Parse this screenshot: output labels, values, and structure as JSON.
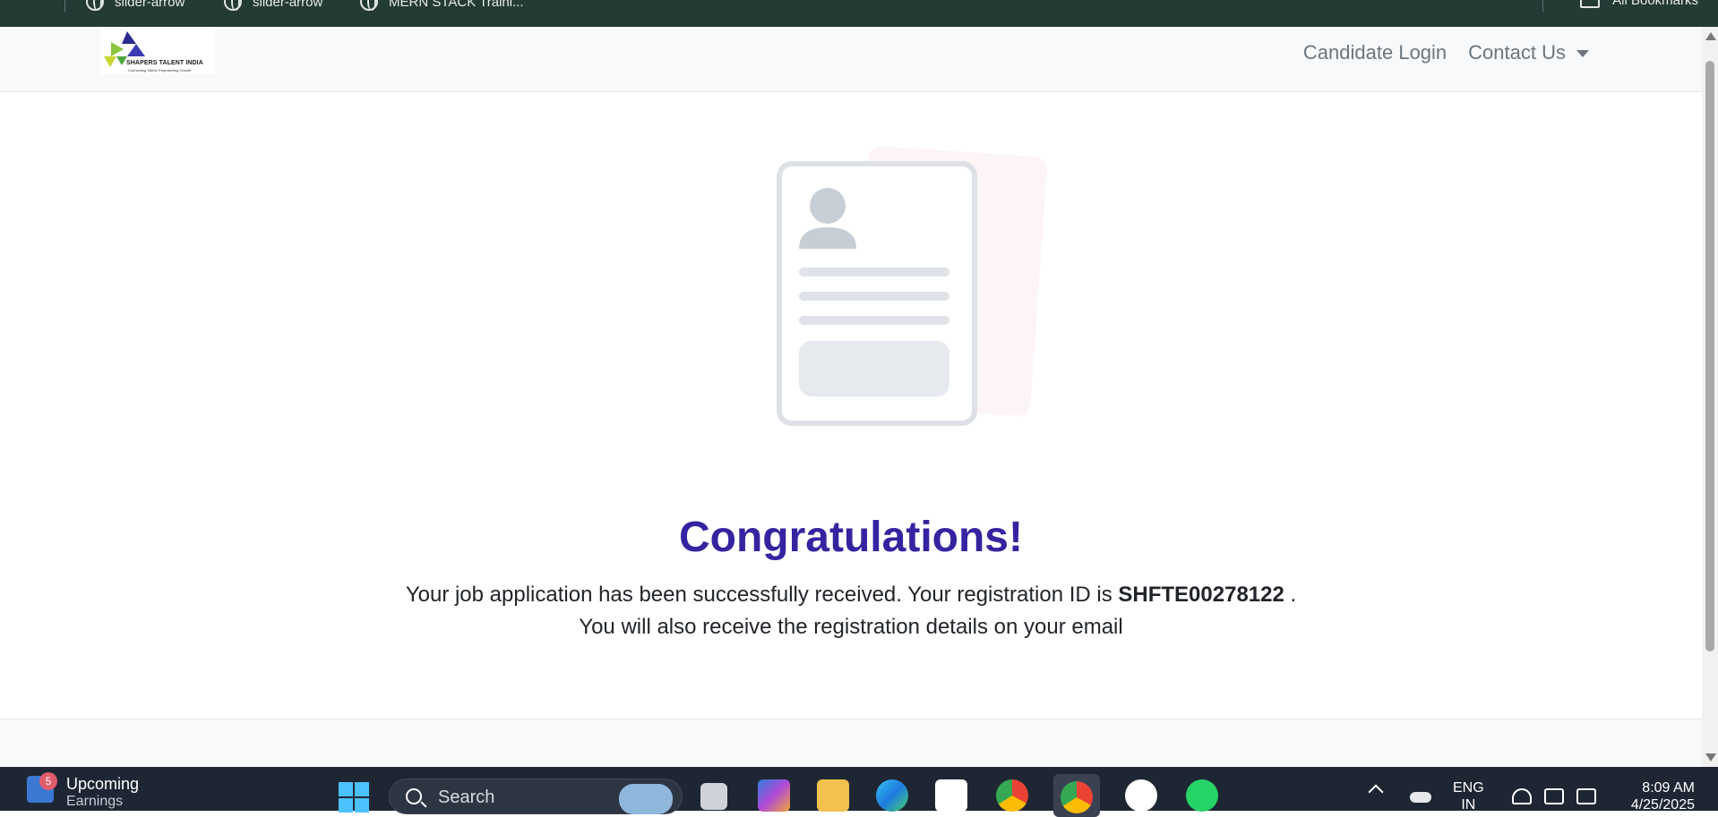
{
  "bookmarks": {
    "items": [
      {
        "label": "slider-arrow"
      },
      {
        "label": "slider-arrow"
      },
      {
        "label": "MERN STACK Traini..."
      }
    ],
    "all_bookmarks": "All Bookmarks"
  },
  "header": {
    "logo": {
      "name": "SHAPERS TALENT INDIA",
      "tagline": "Connecting Talent, Empowering Growth"
    },
    "nav": {
      "candidate_login": "Candidate Login",
      "contact_us": "Contact Us"
    }
  },
  "main": {
    "title": "Congratulations!",
    "message_prefix": "Your job application has been successfully received. Your registration ID is",
    "registration_id": "SHFTE00278122",
    "message_suffix": " .",
    "message_line2": "You will also receive the registration details on your email"
  },
  "colors": {
    "title": "#3524a0",
    "bookmark_bar": "#233a35",
    "taskbar": "#1f2633"
  },
  "taskbar": {
    "widget": {
      "badge": "5",
      "title": "Upcoming",
      "subtitle": "Earnings"
    },
    "search_placeholder": "Search",
    "apps": [
      "task-view-icon",
      "copilot-icon",
      "file-explorer-icon",
      "edge-icon",
      "microsoft-store-icon",
      "chrome-profile-icon",
      "chrome-icon",
      "mongodb-compass-icon",
      "whatsapp-icon"
    ],
    "language": {
      "line1": "ENG",
      "line2": "IN"
    },
    "clock": {
      "time": "8:09 AM",
      "date": "4/25/2025"
    }
  }
}
